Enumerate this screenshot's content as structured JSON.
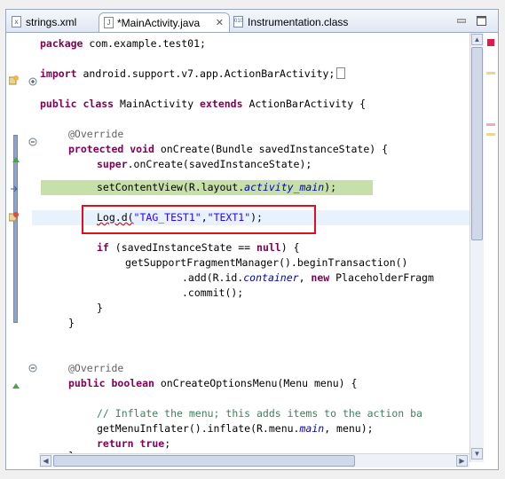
{
  "tabs": [
    {
      "label": "strings.xml",
      "icon": "xml-file-icon"
    },
    {
      "label": "*MainActivity.java",
      "icon": "java-file-icon",
      "active": true
    },
    {
      "label": "Instrumentation.class",
      "icon": "class-file-icon"
    }
  ],
  "code": {
    "line_package": "package com.example.test01;",
    "import_kw": "import",
    "import_rest": " android.support.v7.app.ActionBarActivity;",
    "class_public": "public",
    "class_class": "class",
    "class_name": " MainActivity ",
    "class_extends": "extends",
    "class_rest": " ActionBarActivity {",
    "override1": "@Override",
    "oncreate_protected": "protected",
    "oncreate_void": "void",
    "oncreate_rest": " onCreate(Bundle savedInstanceState) {",
    "super_kw": "super",
    "super_rest": ".onCreate(savedInstanceState);",
    "setcontent_pre": "setContentView(R.layout.",
    "setcontent_field": "activity_main",
    "setcontent_post": ");",
    "log_pre": "Log.d(",
    "log_tag": "\"TAG_TEST1\"",
    "log_comma": ",",
    "log_msg": "\"TEXT1\"",
    "log_post": ");",
    "if_kw": "if",
    "if_mid": " (savedInstanceState == ",
    "if_null": "null",
    "if_post": ") {",
    "fragment_line": "getSupportFragmentManager().beginTransaction()",
    "add_pre": ".add(R.id.",
    "add_field": "container",
    "add_mid": ", ",
    "add_new": "new",
    "add_post": " PlaceholderFragm",
    "commit_line": ".commit();",
    "close_brace_inner": "}",
    "close_brace_method": "}",
    "override2": "@Override",
    "menu_public": "public",
    "menu_boolean": "boolean",
    "menu_rest": " onCreateOptionsMenu(Menu menu) {",
    "comment_line": "// Inflate the menu; this adds items to the action ba",
    "inflate_pre": "getMenuInflater().inflate(R.menu.",
    "inflate_field": "main",
    "inflate_post": ", menu);",
    "return_kw": "return",
    "return_true": "true",
    "return_post": ";",
    "last_brace": "}"
  },
  "colors": {
    "keyword": "#7f0055",
    "string": "#2a00ff",
    "annotation": "#646464",
    "field": "#0000c0",
    "comment": "#3f7f5f",
    "highlight_box": "#e0101a"
  }
}
